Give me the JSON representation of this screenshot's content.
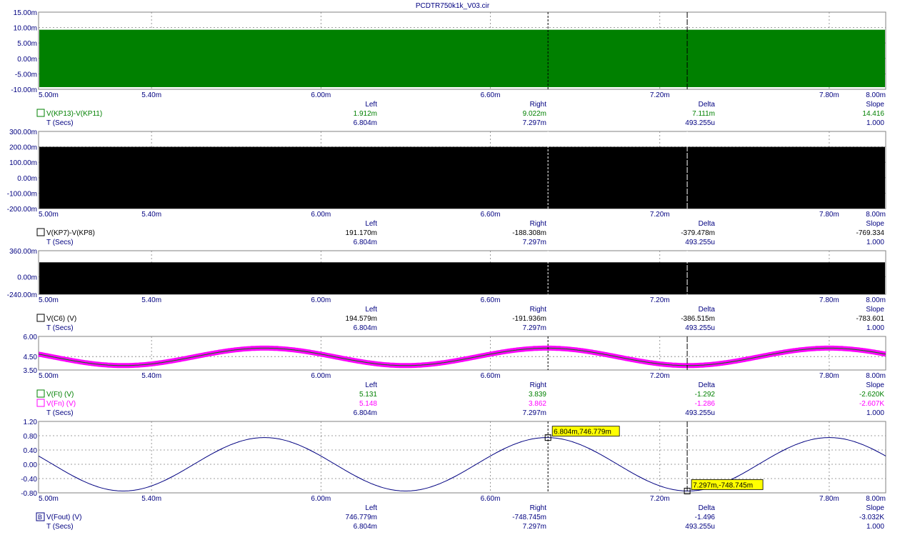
{
  "title": "PCDTR750k1k_V03.cir",
  "colors": {
    "text": "#000080",
    "green": "#008000",
    "black": "#000000",
    "magenta": "#ff00ff",
    "navy": "#000080",
    "grid": "#808080",
    "tooltip_bg": "#ffff00"
  },
  "x_ticks": [
    "5.00m",
    "5.40m",
    "6.00m",
    "6.60m",
    "7.20m",
    "7.80m",
    "8.00m"
  ],
  "col_headers": {
    "left": "Left",
    "right": "Right",
    "delta": "Delta",
    "slope": "Slope"
  },
  "cursors": {
    "left_time": 6.804,
    "right_time": 7.297,
    "x_range": [
      5.0,
      8.0
    ]
  },
  "markers": [
    {
      "label": "6.804m,746.779m",
      "x": 6.804,
      "y": 0.746779
    },
    {
      "label": "7.297m,-748.745m",
      "x": 7.297,
      "y": -0.748745
    }
  ],
  "chart_data": [
    {
      "type": "area",
      "xlabel": "T (Secs)",
      "ylim": [
        -0.01,
        0.015
      ],
      "y_ticks": [
        "15.00m",
        "10.00m",
        "5.00m",
        "0.00m",
        "-5.00m",
        "-10.00m"
      ],
      "band": [
        -0.0093,
        0.0093
      ],
      "series": [
        {
          "name": "V(KP13)-V(KP11)",
          "color": "#008000",
          "marker": "box",
          "left": "1.912m",
          "right": "9.022m",
          "delta": "7.111m",
          "slope": "14.416"
        }
      ],
      "time_row": {
        "left": "6.804m",
        "right": "7.297m",
        "delta": "493.255u",
        "slope": "1.000"
      }
    },
    {
      "type": "area",
      "xlabel": "T (Secs)",
      "ylim": [
        -0.2,
        0.3
      ],
      "y_ticks": [
        "300.00m",
        "200.00m",
        "100.00m",
        "0.00m",
        "-100.00m",
        "-200.00m"
      ],
      "band": [
        -0.2,
        0.2
      ],
      "series": [
        {
          "name": "V(KP7)-V(KP8)",
          "color": "#000000",
          "marker": "box",
          "left": "191.170m",
          "right": "-188.308m",
          "delta": "-379.478m",
          "slope": "-769.334"
        }
      ],
      "time_row": {
        "left": "6.804m",
        "right": "7.297m",
        "delta": "493.255u",
        "slope": "1.000"
      }
    },
    {
      "type": "area",
      "xlabel": "T (Secs)",
      "ylim": [
        -0.24,
        0.36
      ],
      "y_ticks": [
        "360.00m",
        "0.00m",
        "-240.00m"
      ],
      "band": [
        -0.24,
        0.2
      ],
      "series": [
        {
          "name": "V(C6) (V)",
          "color": "#000000",
          "marker": "box",
          "left": "194.579m",
          "right": "-191.936m",
          "delta": "-386.515m",
          "slope": "-783.601"
        }
      ],
      "time_row": {
        "left": "6.804m",
        "right": "7.297m",
        "delta": "493.255u",
        "slope": "1.000"
      }
    },
    {
      "type": "line",
      "xlabel": "T (Secs)",
      "ylim": [
        3.5,
        6.0
      ],
      "y_ticks": [
        "6.00",
        "4.50",
        "3.50"
      ],
      "sine": {
        "offset": 4.48,
        "amplitude": 0.65,
        "period": 1.0,
        "peak_at": 5.8
      },
      "series": [
        {
          "name": "V(Ft) (V)",
          "color": "#008000",
          "marker": "box",
          "left": "5.131",
          "right": "3.839",
          "delta": "-1.292",
          "slope": "-2.620K"
        },
        {
          "name": "V(Fn) (V)",
          "color": "#ff00ff",
          "marker": "box",
          "left": "5.148",
          "right": "3.862",
          "delta": "-1.286",
          "slope": "-2.607K"
        }
      ],
      "time_row": {
        "left": "6.804m",
        "right": "7.297m",
        "delta": "493.255u",
        "slope": "1.000"
      }
    },
    {
      "type": "line",
      "xlabel": "T (Secs)",
      "ylim": [
        -0.8,
        1.2
      ],
      "y_ticks": [
        "1.20",
        "0.80",
        "0.40",
        "0.00",
        "-0.40",
        "-0.80"
      ],
      "sine": {
        "offset": 0.0,
        "amplitude": 0.7478,
        "period": 1.0,
        "peak_at": 5.8
      },
      "series": [
        {
          "name": "V(Fout) (V)",
          "color": "#000080",
          "marker": "B",
          "left": "746.779m",
          "right": "-748.745m",
          "delta": "-1.496",
          "slope": "-3.032K"
        }
      ],
      "time_row": {
        "left": "6.804m",
        "right": "7.297m",
        "delta": "493.255u",
        "slope": "1.000"
      }
    }
  ]
}
